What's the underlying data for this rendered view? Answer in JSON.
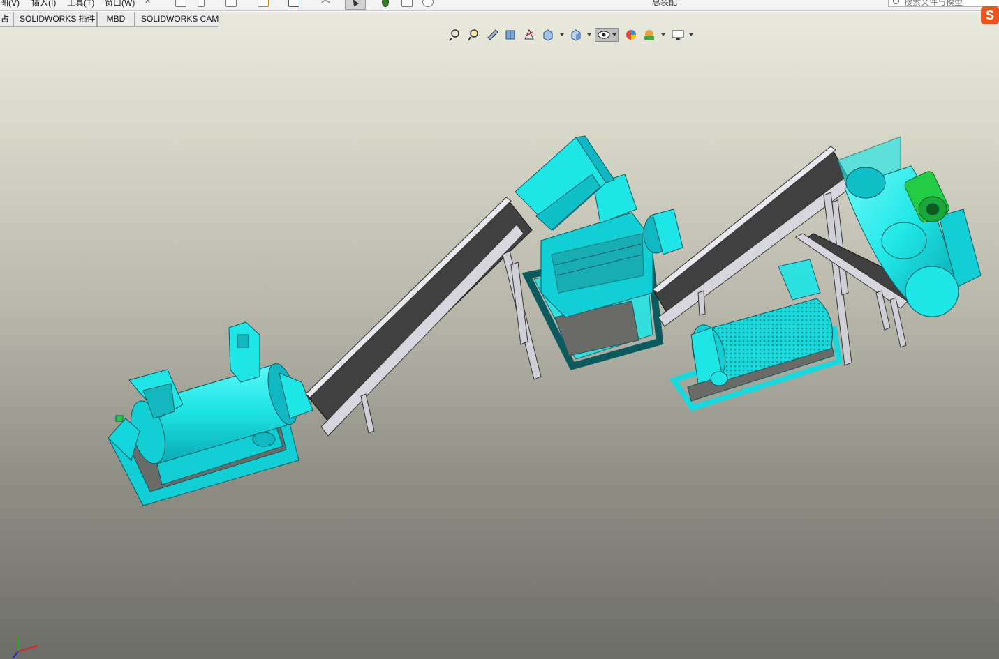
{
  "menu": {
    "items": [
      "图(V)",
      "插入(I)",
      "工具(T)",
      "窗口(W)"
    ],
    "pin_glyph": "✕"
  },
  "toolbar": {
    "icons": [
      "home-icon",
      "new-file-icon",
      "sketch-icon",
      "rebuild-warning-icon",
      "print-icon",
      "undo-icon",
      "select-arrow-icon",
      "traffic-light-icon",
      "file-properties-icon",
      "options-gear-icon"
    ]
  },
  "document": {
    "title": "总装配"
  },
  "search": {
    "placeholder": "搜索文件与模型"
  },
  "ime": {
    "label": "S"
  },
  "command_tabs": [
    {
      "label": "占"
    },
    {
      "label": "SOLIDWORKS 插件"
    },
    {
      "label": "MBD"
    },
    {
      "label": "SOLIDWORKS CAM"
    }
  ],
  "view_toolbar": {
    "icons": [
      "zoom-to-fit-icon",
      "zoom-to-area-icon",
      "previous-view-icon",
      "section-view-icon",
      "dynamic-annotation-icon",
      "view-orientation-icon",
      "display-style-icon",
      "hide-show-items-icon",
      "edit-appearance-icon",
      "apply-scene-icon",
      "view-settings-icon"
    ]
  },
  "colors": {
    "model_cyan": "#1ee6e6",
    "model_cyan_dark": "#0fb8c2",
    "belt": "#404040",
    "frame": "#cfcfd8",
    "motor_green": "#22cc44",
    "accent_orange": "#f0521d"
  },
  "triad": {
    "axes": [
      "x",
      "y",
      "z"
    ]
  }
}
